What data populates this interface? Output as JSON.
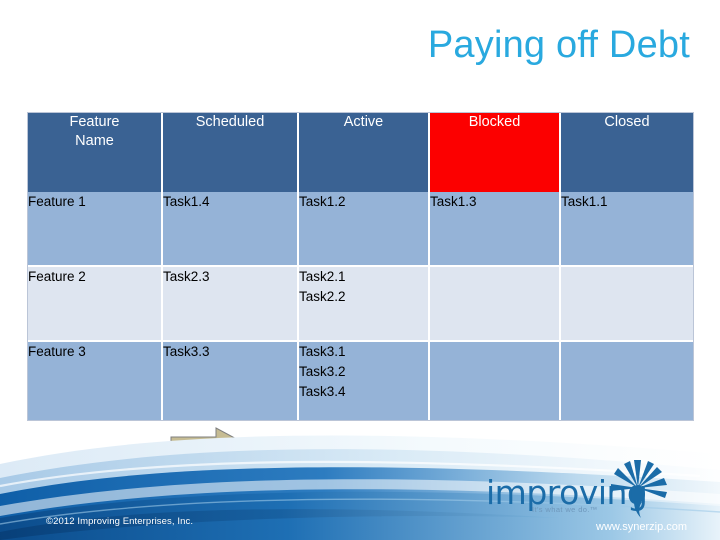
{
  "slide": {
    "title": "Paying off Debt",
    "title_color": "#29A9DF",
    "background_color": "#FFFFFF"
  },
  "table": {
    "header_color": "#3A6293",
    "blocked_header_color": "#FC0000",
    "row_dark_color": "#95B3D7",
    "row_light_color": "#DEE5F0",
    "columns": [
      {
        "key": "feature",
        "label_line1": "Feature",
        "label_line2": "Name",
        "highlight": false
      },
      {
        "key": "scheduled",
        "label_line1": "Scheduled",
        "label_line2": "",
        "highlight": false
      },
      {
        "key": "active",
        "label_line1": "Active",
        "label_line2": "",
        "highlight": false
      },
      {
        "key": "blocked",
        "label_line1": "Blocked",
        "label_line2": "",
        "highlight": true
      },
      {
        "key": "closed",
        "label_line1": "Closed",
        "label_line2": "",
        "highlight": false
      }
    ],
    "rows": [
      {
        "feature": "Feature  1",
        "scheduled": [
          "Task1.4"
        ],
        "active": [
          "Task1.2"
        ],
        "blocked": [
          "Task1.3"
        ],
        "closed": [
          "Task1.1"
        ]
      },
      {
        "feature": "Feature  2",
        "scheduled": [
          "Task2.3"
        ],
        "active": [
          "Task2.1",
          "Task2.2"
        ],
        "blocked": [],
        "closed": []
      },
      {
        "feature": "Feature  3",
        "scheduled": [
          "Task3.3"
        ],
        "active": [
          "Task3.1",
          "Task3.2",
          "Task3.4"
        ],
        "blocked": [],
        "closed": []
      }
    ]
  },
  "arrow": {
    "icon": "right-block-arrow-icon",
    "fill_color": "#C6BC93",
    "outline_color": "#7F7F7F"
  },
  "footer": {
    "copyright": "©2012 Improving Enterprises, Inc.",
    "url": "www.synerzip.com"
  },
  "logo": {
    "wordmark": "improving",
    "tagline": "It's what we do.™",
    "burst_icon": "starburst-icon",
    "color": "#1B6CA8"
  }
}
